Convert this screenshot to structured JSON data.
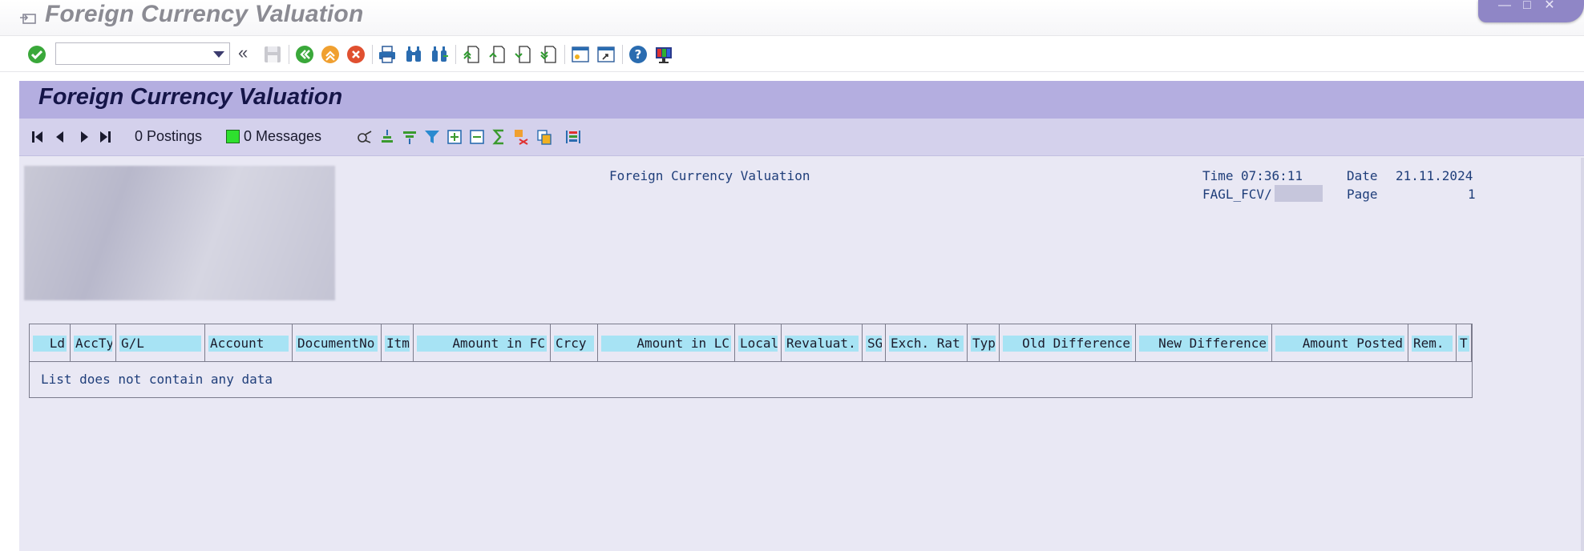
{
  "window": {
    "title": "Foreign Currency Valuation"
  },
  "toolbar": {
    "command_value": ""
  },
  "app": {
    "title": "Foreign Currency Valuation"
  },
  "list_toolbar": {
    "postings": "0 Postings",
    "messages": "0 Messages",
    "status_color": "#2ee02e"
  },
  "report": {
    "title": "Foreign Currency Valuation",
    "time_label": "Time",
    "time": "07:36:11",
    "date_label": "Date",
    "date": "21.11.2024",
    "program": "FAGL_FCV/",
    "page_label": "Page",
    "page": "1"
  },
  "table": {
    "columns": [
      "Ld",
      "AccTy",
      "G/L",
      "Account",
      "DocumentNo",
      "Itm",
      "Amount in FC",
      "Crcy",
      "Amount in LC",
      "Local",
      "Revaluat.",
      "SG",
      "Exch. Rat",
      "Typ",
      "Old Difference",
      "New Difference",
      "Amount Posted",
      "Rem.",
      "T"
    ],
    "empty_message": "List does not contain any data"
  },
  "colors": {
    "header_band": "#b4aee0",
    "list_toolbar": "#d4d1ec",
    "body": "#e9e8f4",
    "column_header": "#a7e3f4",
    "text_blue": "#1f3e7a"
  }
}
